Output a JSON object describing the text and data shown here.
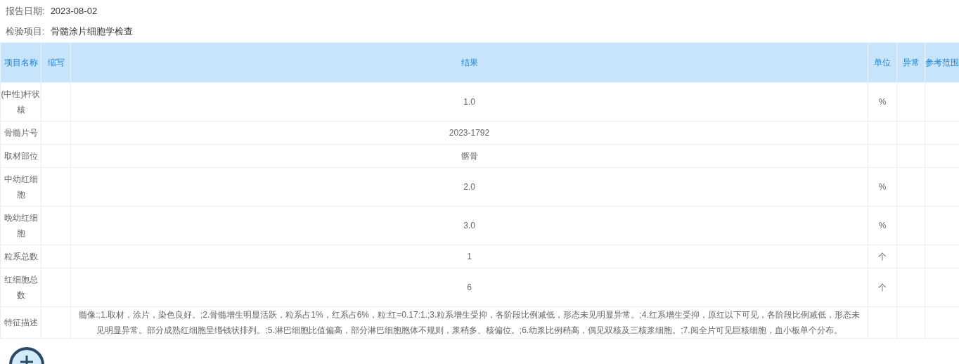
{
  "report_info": [
    {
      "label": "报告日期:",
      "value": "2023-08-02"
    },
    {
      "label": "检验项目:",
      "value": "骨髓涂片细胞学检查"
    }
  ],
  "table": {
    "columns": [
      "项目名称",
      "缩写",
      "结果",
      "单位",
      "异常",
      "参考范围"
    ],
    "rows": [
      {
        "name": "(中性)杆状核",
        "result": "1.0",
        "unit": "%"
      },
      {
        "name": "骨髓片号",
        "result": "2023-1792"
      },
      {
        "name": "取材部位",
        "result": "髂骨"
      },
      {
        "name": "中幼红细胞",
        "result": "2.0",
        "unit": "%"
      },
      {
        "name": "晚幼红细胞",
        "result": "3.0",
        "unit": "%"
      },
      {
        "name": "粒系总数",
        "result": "1",
        "unit": "个"
      },
      {
        "name": "红细胞总数",
        "result": "6",
        "unit": "个"
      },
      {
        "name": "特征描述",
        "result": "髓像:;1.取材，涂片，染色良好。;2.骨髓增生明显活跃，粒系占1%，红系占6%，粒:红=0.17:1.;3.粒系增生受抑，各阶段比例减低，形态未见明显异常。;4.红系增生受抑，原红以下可见，各阶段比例减低，形态未见明显异常。部分成熟红细胞呈缗钱状排列。;5.淋巴细胞比值偏高，部分淋巴细胞胞体不规则，浆稍多、核偏位。;6.幼浆比例稍高，偶见双核及三核浆细胞。;7.阅全片可见巨核细胞，血小板单个分布。"
      }
    ]
  }
}
